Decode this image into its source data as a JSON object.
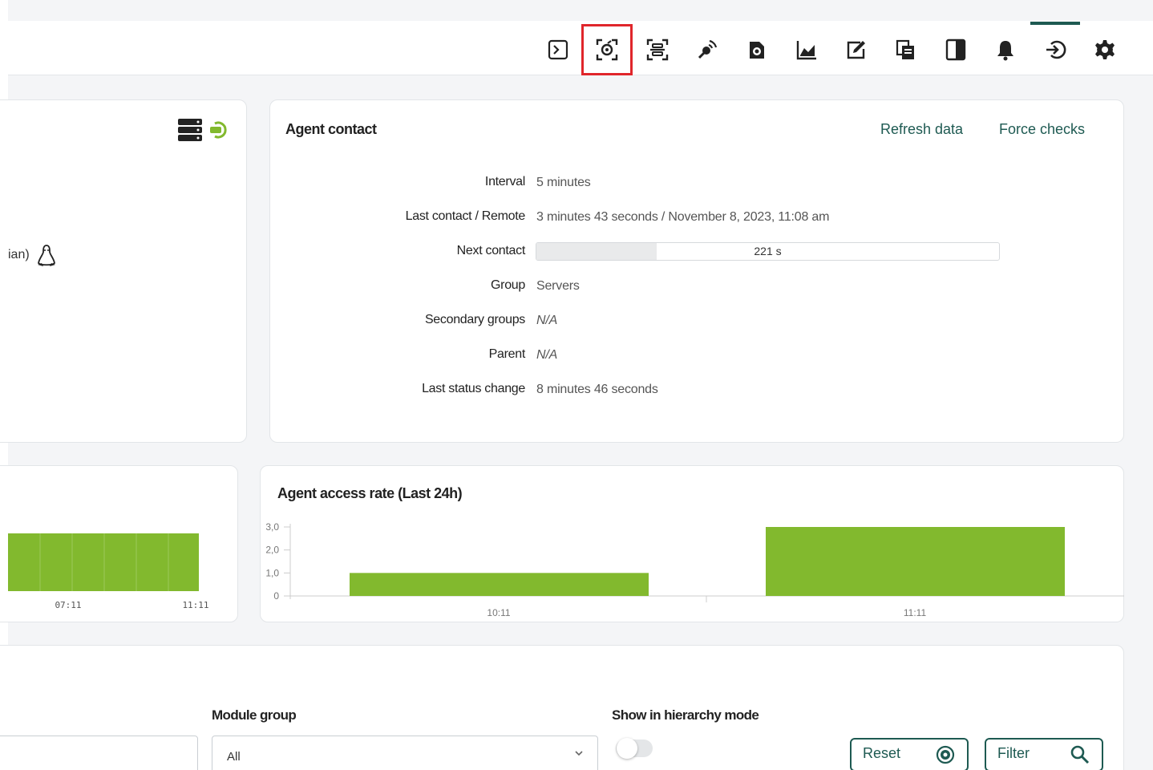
{
  "colors": {
    "accent": "#1e5a52",
    "bar_green": "#82b92e",
    "highlight": "#e0262b"
  },
  "toolbar": {
    "icons": [
      "terminal-icon",
      "scan-agent-icon",
      "qr-scan-icon",
      "remote-control-icon",
      "policy-icon",
      "chart-icon",
      "edit-icon",
      "copy-icon",
      "sidebar-toggle-icon",
      "bell-icon",
      "logout-icon",
      "gear-icon"
    ],
    "highlighted": "scan-agent-icon"
  },
  "left_panel": {
    "os_text": "ian)"
  },
  "agent_contact": {
    "title": "Agent contact",
    "refresh_label": "Refresh data",
    "force_label": "Force checks",
    "rows": [
      {
        "label": "Interval",
        "value": "5 minutes"
      },
      {
        "label": "Last contact / Remote",
        "value": "3 minutes 43 seconds / November 8, 2023, 11:08 am"
      },
      {
        "label": "Next contact",
        "value": "221 s"
      },
      {
        "label": "Group",
        "value": "Servers"
      },
      {
        "label": "Secondary groups",
        "value": "N/A"
      },
      {
        "label": "Parent",
        "value": "N/A"
      },
      {
        "label": "Last status change",
        "value": "8 minutes 46 seconds"
      }
    ],
    "next_contact_progress": 0.26
  },
  "chart_data": [
    {
      "type": "bar",
      "title": "",
      "categories": [
        "07:11",
        "11:11"
      ],
      "values": [
        2.5,
        2.5
      ]
    },
    {
      "type": "bar",
      "title": "Agent access rate (Last 24h)",
      "categories": [
        "10:11",
        "11:11"
      ],
      "values": [
        1.0,
        3.0
      ],
      "yticks": [
        "3,0",
        "2,0",
        "1,0",
        "0"
      ],
      "ylim": [
        0,
        3
      ]
    }
  ],
  "filters": {
    "module_group_label": "Module group",
    "module_group_value": "All",
    "hierarchy_label": "Show in hierarchy mode",
    "reset_label": "Reset",
    "filter_label": "Filter"
  }
}
